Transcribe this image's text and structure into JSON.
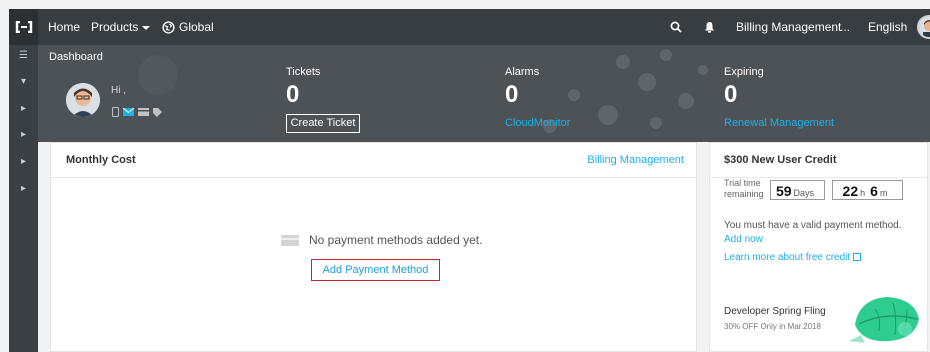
{
  "topbar": {
    "nav": {
      "home": "Home",
      "products": "Products",
      "global": "Global",
      "billing": "Billing Management",
      "more": "...",
      "language": "English"
    },
    "icons": [
      "logo-icon",
      "globe-icon",
      "search-icon",
      "bell-icon",
      "avatar"
    ]
  },
  "hero": {
    "title": "Dashboard",
    "greeting": "Hi ,",
    "stats": [
      {
        "label": "Tickets",
        "value": "0",
        "action": "Create Ticket"
      },
      {
        "label": "Alarms",
        "value": "0",
        "link": "CloudMonitor"
      },
      {
        "label": "Expiring",
        "value": "0",
        "link": "Renewal Management"
      }
    ]
  },
  "monthly_cost": {
    "title": "Monthly Cost",
    "link": "Billing Management",
    "empty_message": "No payment methods added yet.",
    "add_button": "Add Payment Method"
  },
  "credit": {
    "title": "$300 New User Credit",
    "trial_label": "Trial time remaining",
    "days": {
      "value": "59",
      "unit": "Days"
    },
    "hours": {
      "value": "22",
      "unit": "h"
    },
    "minutes": {
      "value": "6",
      "unit": "m"
    },
    "notice": "You must have a valid payment method.",
    "add_now": "Add now",
    "learn_more": "Learn more about free credit",
    "promo_title": "Developer Spring Fling",
    "promo_sub": "30% OFF Only in Mar.2018"
  },
  "colors": {
    "accent": "#1fb0e8",
    "topbar": "#373d41",
    "highlight_border": "#c9262a"
  }
}
